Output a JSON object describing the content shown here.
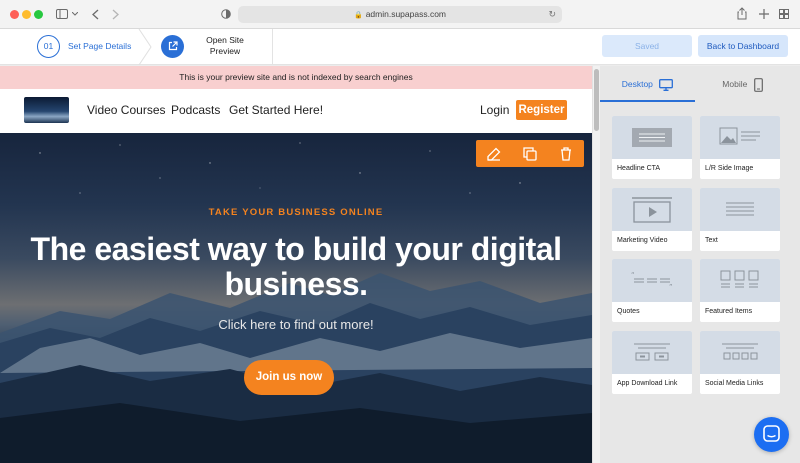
{
  "browser": {
    "url": "admin.supapass.com"
  },
  "appbar": {
    "step1_number": "01",
    "step1_label": "Set Page Details",
    "step2_label": "Open Site Preview",
    "saved_label": "Saved",
    "dashboard_label": "Back to Dashboard"
  },
  "preview": {
    "notice": "This is your preview site and is not indexed by search engines",
    "nav": {
      "links": [
        "Video Courses",
        "Podcasts",
        "Get Started Here!"
      ],
      "login": "Login",
      "register": "Register"
    },
    "hero": {
      "eyebrow": "TAKE YOUR BUSINESS ONLINE",
      "title": "The easiest way to build your digital business.",
      "subtitle": "Click here to find out more!",
      "cta": "Join us now"
    },
    "colors": {
      "accent": "#f4831f",
      "primary": "#2a6fd6",
      "notice_bg": "#f8cfcf"
    }
  },
  "panel": {
    "tabs": [
      "Desktop",
      "Mobile"
    ],
    "blocks": [
      "Headline CTA",
      "L/R Side Image",
      "Marketing Video",
      "Text",
      "Quotes",
      "Featured Items",
      "App Download Link",
      "Social Media Links"
    ]
  }
}
